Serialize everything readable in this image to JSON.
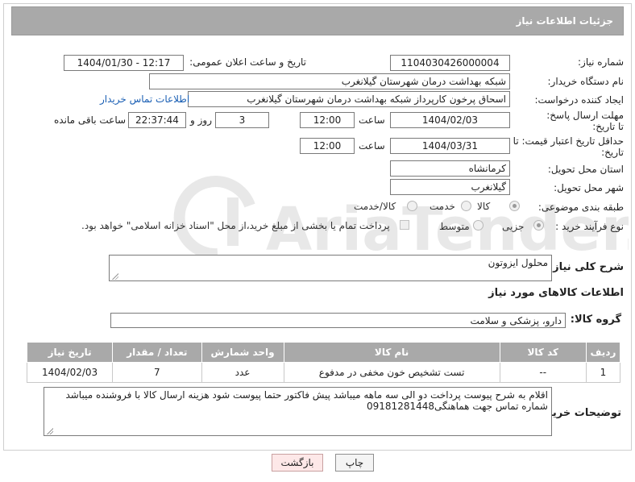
{
  "header": {
    "title": "جزئیات اطلاعات نیاز"
  },
  "form": {
    "need_number": {
      "label": "شماره نیاز:",
      "value": "1104030426000004"
    },
    "announce_datetime": {
      "label": "تاریخ و ساعت اعلان عمومی:",
      "value": "1404/01/30 - 12:17"
    },
    "buyer_org": {
      "label": "نام دستگاه خریدار:",
      "value": "شبکه بهداشت درمان شهرستان گیلانغرب"
    },
    "requester": {
      "label": "ایجاد کننده درخواست:",
      "value": "اسحاق پرخون کارپرداز شبکه بهداشت درمان شهرستان گیلانغرب",
      "contact_link": "اطلاعات تماس خریدار"
    },
    "response_deadline": {
      "label": "مهلت ارسال پاسخ: تا تاریخ:",
      "date": "1404/02/03",
      "time_label": "ساعت",
      "time": "12:00",
      "days": "3",
      "days_label": "روز و",
      "remaining": "22:37:44",
      "remaining_label": "ساعت باقی مانده"
    },
    "price_validity": {
      "label": "حداقل تاریخ اعتبار قیمت: تا تاریخ:",
      "date": "1404/03/31",
      "time_label": "ساعت",
      "time": "12:00"
    },
    "province": {
      "label": "استان محل تحویل:",
      "value": "کرمانشاه"
    },
    "city": {
      "label": "شهر محل تحویل:",
      "value": "گیلانغرب"
    },
    "category": {
      "label": "طبقه بندی موضوعی:",
      "options": [
        "کالا",
        "خدمت",
        "کالا/خدمت"
      ],
      "selected": "کالا"
    },
    "purchase_type": {
      "label": "نوع فرآیند خرید :",
      "options": [
        "جزیی",
        "متوسط"
      ],
      "selected": "جزیی",
      "payment_note": "پرداخت تمام یا بخشی از مبلغ خرید،از محل \"اسناد خزانه اسلامی\" خواهد بود."
    }
  },
  "need_description": {
    "label": "شرح کلی نیاز:",
    "value": "محلول ایزوتون"
  },
  "goods_info": {
    "title": "اطلاعات کالاهای مورد نیاز",
    "group_label": "گروه کالا:",
    "group_value": "دارو، پزشکی و سلامت"
  },
  "items_table": {
    "columns": [
      "ردیف",
      "کد کالا",
      "نام کالا",
      "واحد شمارش",
      "تعداد / مقدار",
      "تاریخ نیاز"
    ],
    "rows": [
      [
        "1",
        "--",
        "تست تشخیص خون مخفی در مدفوع",
        "عدد",
        "7",
        "1404/02/03"
      ]
    ]
  },
  "buyer_notes": {
    "label": "توضیحات خریدار:",
    "value": "اقلام به شرح پیوست پرداخت دو الی سه ماهه میباشد پیش فاکتور حتما پیوست شود هزینه ارسال کالا با فروشنده میباشد شماره تماس جهت هماهنگی09181281448"
  },
  "buttons": {
    "print": "چاپ",
    "back": "بازگشت"
  },
  "watermark": {
    "text": "AriaTender.net"
  },
  "colors": {
    "header_bg": "#a9a9a9",
    "link": "#1a5fb4",
    "back_button_bg": "#fde8e8"
  },
  "icons": {
    "resize_grip": "resize-grip-icon",
    "watermark_logo": "aria-tender-logo"
  }
}
